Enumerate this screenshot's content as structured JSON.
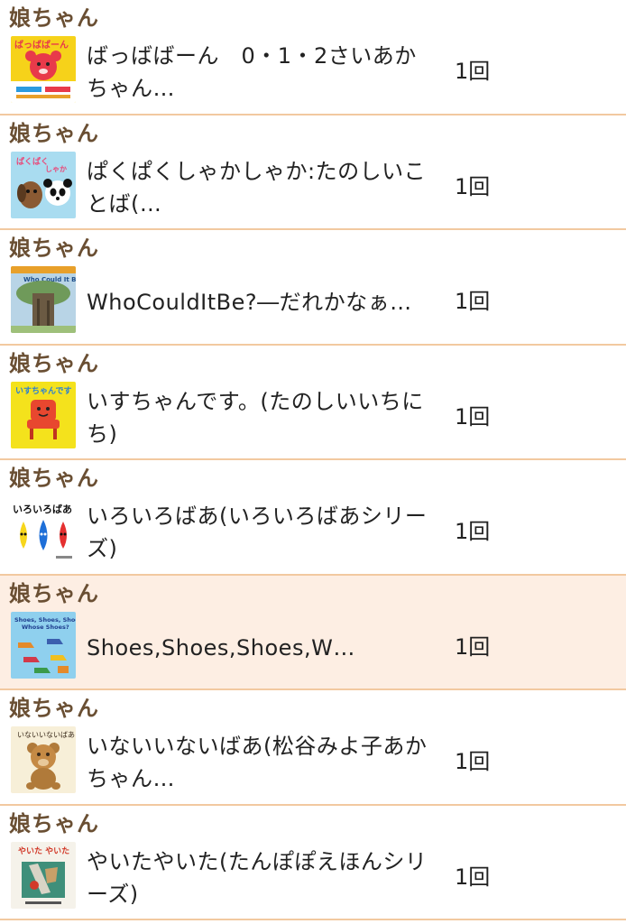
{
  "entries": [
    {
      "reader": "娘ちゃん",
      "title": "ばっばばーん　0・1・2さいあかちゃん…",
      "count": "1回",
      "cover_icon": "red-bear-book-cover-icon",
      "cover_text": "ばっばばーん",
      "cover_colors": [
        "#f6d21a",
        "#e83a4a",
        "#2b9be0"
      ]
    },
    {
      "reader": "娘ちゃん",
      "title": "ぱくぱくしゃかしゃか:たのしいことば(…",
      "count": "1回",
      "cover_icon": "dog-panda-book-cover-icon",
      "cover_text": "ぱくぱく しゃかしゃか",
      "cover_colors": [
        "#a9dcf0",
        "#8a5a33",
        "#ffffff"
      ]
    },
    {
      "reader": "娘ちゃん",
      "title": "WhoCouldItBe?―だれかなぁ…",
      "count": "1回",
      "cover_icon": "tree-book-cover-icon",
      "cover_text": "Who Could It Be?",
      "cover_colors": [
        "#5a86a8",
        "#6b5a43",
        "#9ec07a"
      ]
    },
    {
      "reader": "娘ちゃん",
      "title": "いすちゃんです。(たのしいいちにち)",
      "count": "1回",
      "cover_icon": "red-chair-book-cover-icon",
      "cover_text": "いすちゃんです",
      "cover_colors": [
        "#f4e21c",
        "#e8472f",
        "#2a7fd4"
      ]
    },
    {
      "reader": "娘ちゃん",
      "title": "いろいろばあ(いろいろばあシリーズ)",
      "count": "1回",
      "cover_icon": "color-drops-book-cover-icon",
      "cover_text": "いろいろばあ",
      "cover_colors": [
        "#f7d61b",
        "#1e6fd8",
        "#e53030"
      ]
    },
    {
      "reader": "娘ちゃん",
      "title": "Shoes,Shoes,Shoes,W…",
      "count": "1回",
      "cover_icon": "shoes-book-cover-icon",
      "cover_text": "Shoes, Shoes, Shoes, Whose Shoes?",
      "cover_colors": [
        "#8fd0ee",
        "#e48a2a",
        "#3b5fae"
      ],
      "highlighted": true
    },
    {
      "reader": "娘ちゃん",
      "title": "いないいないばあ(松谷みよ子あかちゃん…",
      "count": "1回",
      "cover_icon": "bear-peekaboo-book-cover-icon",
      "cover_text": "いないいないばあ",
      "cover_colors": [
        "#f7efd8",
        "#b07a3a",
        "#3a2a1a"
      ]
    },
    {
      "reader": "娘ちゃん",
      "title": "やいたやいた(たんぽぽえほんシリーズ)",
      "count": "1回",
      "cover_icon": "baked-bread-book-cover-icon",
      "cover_text": "やいた やいた",
      "cover_colors": [
        "#f5f2ea",
        "#3f8f7a",
        "#d23a2a"
      ]
    }
  ]
}
